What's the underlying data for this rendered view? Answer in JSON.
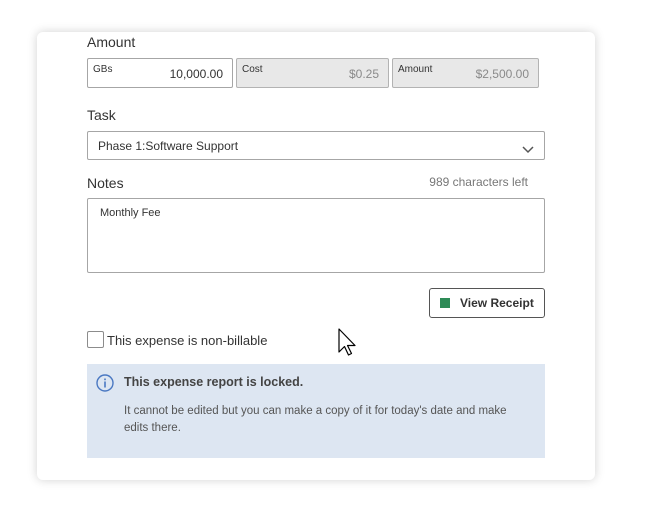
{
  "amount": {
    "section_label": "Amount",
    "gbs": {
      "label": "GBs",
      "value": "10,000.00"
    },
    "cost": {
      "label": "Cost",
      "value": "$0.25"
    },
    "total": {
      "label": "Amount",
      "value": "$2,500.00"
    }
  },
  "task": {
    "section_label": "Task",
    "selected": "Phase 1:Software Support",
    "icon": "chevron-down-icon"
  },
  "notes": {
    "section_label": "Notes",
    "chars_left": "989 characters left",
    "value": "Monthly Fee"
  },
  "receipt": {
    "label": "View Receipt",
    "icon_color": "#2e8b57"
  },
  "non_billable": {
    "label": "This expense is non-billable",
    "checked": false
  },
  "locked_notice": {
    "title": "This expense report is locked.",
    "body": "It cannot be edited but you can make a copy of it for today's date and make edits there.",
    "icon": "info-icon",
    "background": "#dde6f2"
  }
}
